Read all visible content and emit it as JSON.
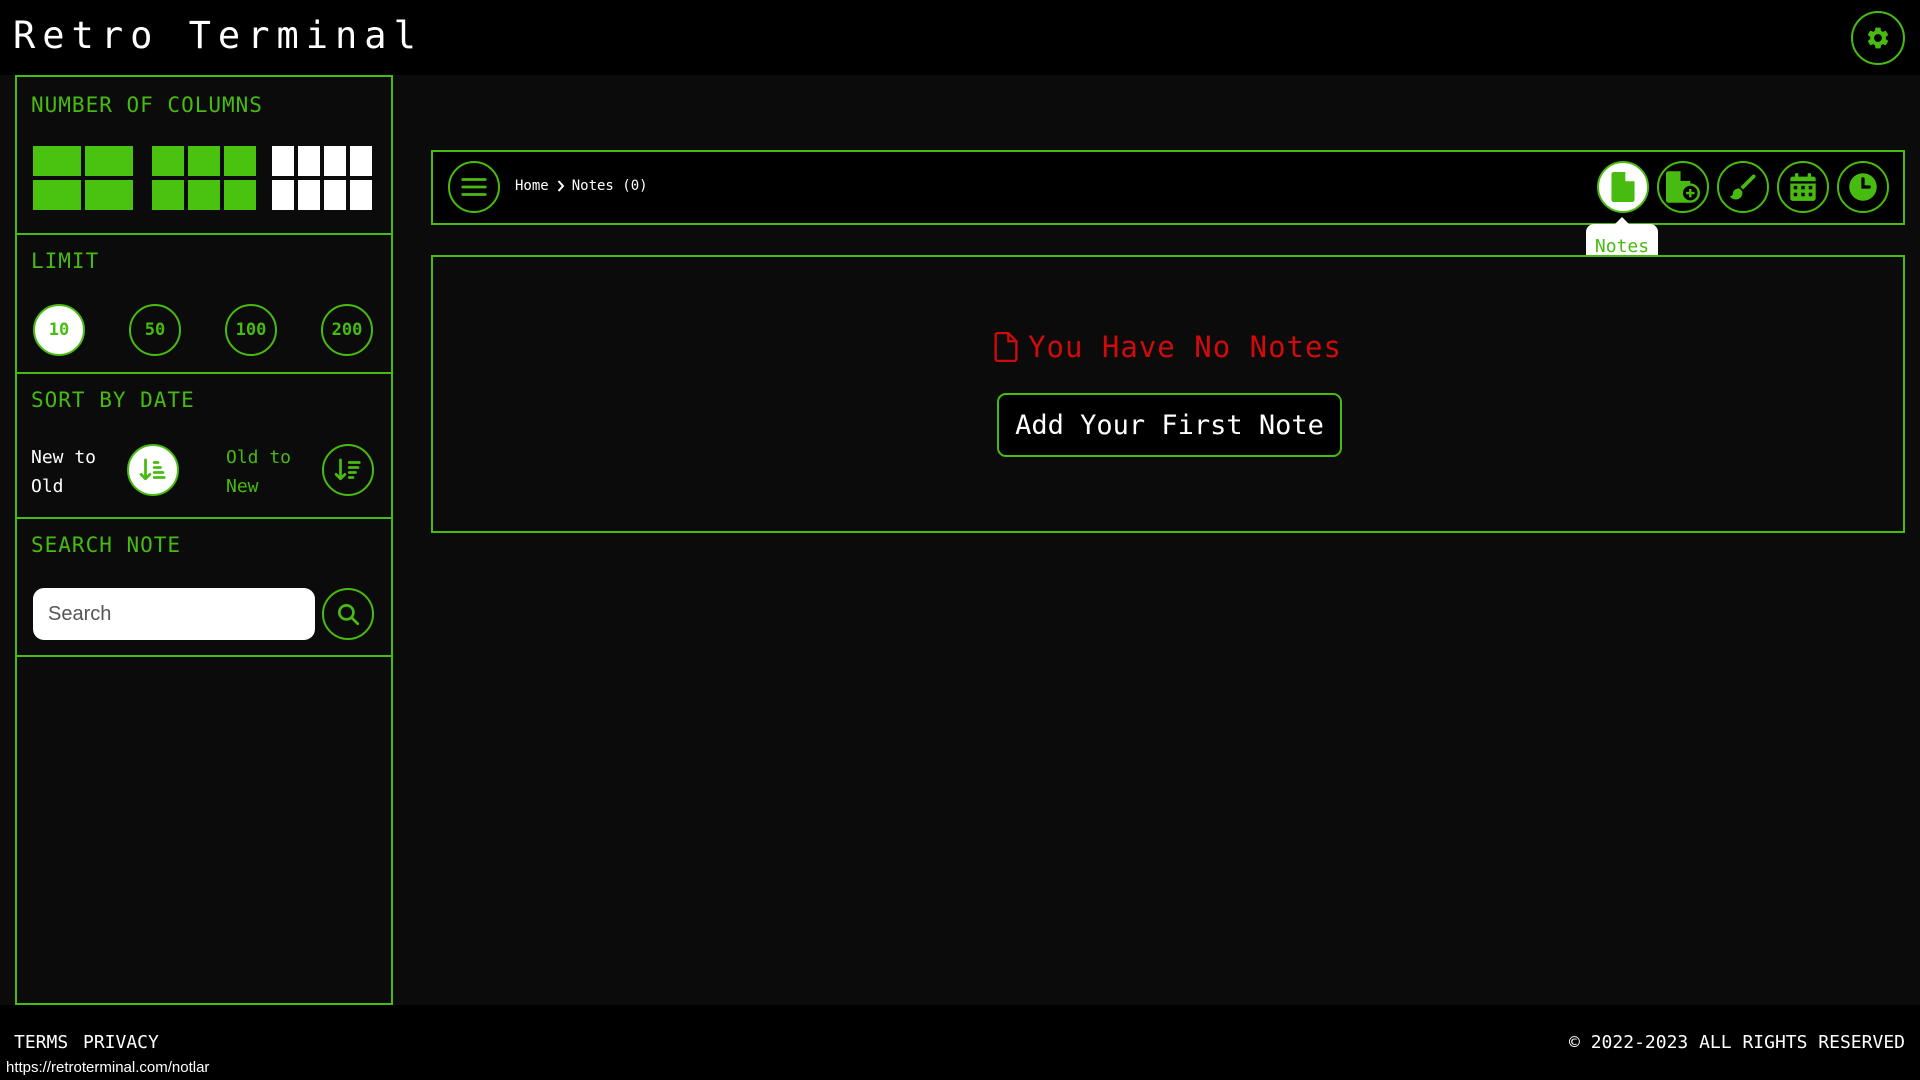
{
  "app": {
    "title": "Retro Terminal"
  },
  "header": {
    "settings_icon": "gear-icon"
  },
  "sidebar": {
    "columns": {
      "title": "NUMBER OF COLUMNS",
      "options": [
        2,
        3,
        4
      ],
      "selected": 4
    },
    "limit": {
      "title": "LIMIT",
      "options": [
        "10",
        "50",
        "100",
        "200"
      ],
      "selected": "10"
    },
    "sort": {
      "title": "SORT BY DATE",
      "new_to_old_label": "New to Old",
      "old_to_new_label": "Old to New",
      "selected": "new_to_old"
    },
    "search": {
      "title": "SEARCH NOTE",
      "placeholder": "Search",
      "value": "",
      "icon": "search-icon"
    }
  },
  "toolbar": {
    "menu_icon": "menu-icon",
    "breadcrumb": {
      "home": "Home",
      "current": "Notes (0)"
    },
    "tools": [
      {
        "name": "notes",
        "icon": "file-icon",
        "active": true
      },
      {
        "name": "add-note",
        "icon": "file-plus-icon",
        "active": false
      },
      {
        "name": "draw",
        "icon": "brush-icon",
        "active": false
      },
      {
        "name": "calendar",
        "icon": "calendar-icon",
        "active": false
      },
      {
        "name": "history",
        "icon": "clock-icon",
        "active": false
      }
    ],
    "tooltip": "Notes"
  },
  "main": {
    "empty_message": "You Have No Notes",
    "empty_icon": "file-icon",
    "add_button_label": "Add Your First Note"
  },
  "footer": {
    "terms": "TERMS",
    "privacy": "PRIVACY",
    "copyright": "© 2022-2023 ALL RIGHTS RESERVED"
  },
  "status_bar": {
    "url": "https://retroterminal.com/notlar"
  },
  "colors": {
    "accent": "#48bb10",
    "danger": "#d10a0a",
    "background": "#0b0b0b",
    "bar": "#000000"
  }
}
